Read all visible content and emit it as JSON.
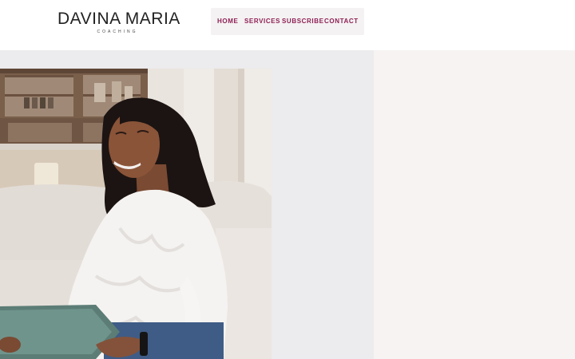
{
  "brand": {
    "name": "DAVINA MARIA",
    "tagline": "COACHING"
  },
  "nav": {
    "items": [
      {
        "label": "HOME"
      },
      {
        "label": "SERVICES"
      },
      {
        "label": "SUBSCRIBE"
      },
      {
        "label": "CONTACT"
      }
    ]
  },
  "colors": {
    "accent": "#8e1f55",
    "nav_background": "#f4f2f2",
    "hero_left_background": "#ecebed",
    "hero_right_background": "#f7f3f3"
  },
  "hero": {
    "image": "woman-smiling-with-tablet-photo"
  }
}
